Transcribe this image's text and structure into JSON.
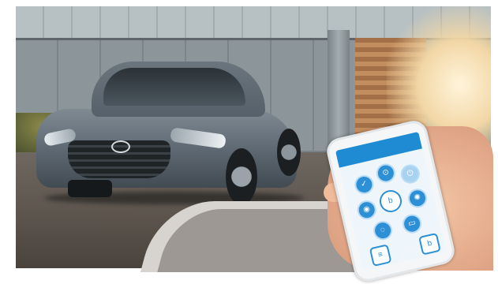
{
  "scene": {
    "description_icons": [
      "car-icon",
      "smartphone-icon",
      "hand-icon"
    ],
    "colors": {
      "car": "#5c6670",
      "app_accent": "#1f8bd3",
      "sunlight": "#f2d7a6"
    }
  },
  "phone_app": {
    "header_text": "",
    "buttons": [
      {
        "icon": "check-icon",
        "glyph": "✓"
      },
      {
        "icon": "lock-icon",
        "glyph": "⊙"
      },
      {
        "icon": "power-icon",
        "glyph": "⏻"
      },
      {
        "icon": "brand-logo-icon",
        "glyph": "b"
      },
      {
        "icon": "horn-icon",
        "glyph": "◉"
      },
      {
        "icon": "light-icon",
        "glyph": "✺"
      },
      {
        "icon": "unlock-icon",
        "glyph": "◌"
      },
      {
        "icon": "trunk-icon",
        "glyph": "▭"
      },
      {
        "icon": "menu-icon",
        "glyph": "≡"
      },
      {
        "icon": "info-icon",
        "glyph": "b"
      }
    ]
  }
}
